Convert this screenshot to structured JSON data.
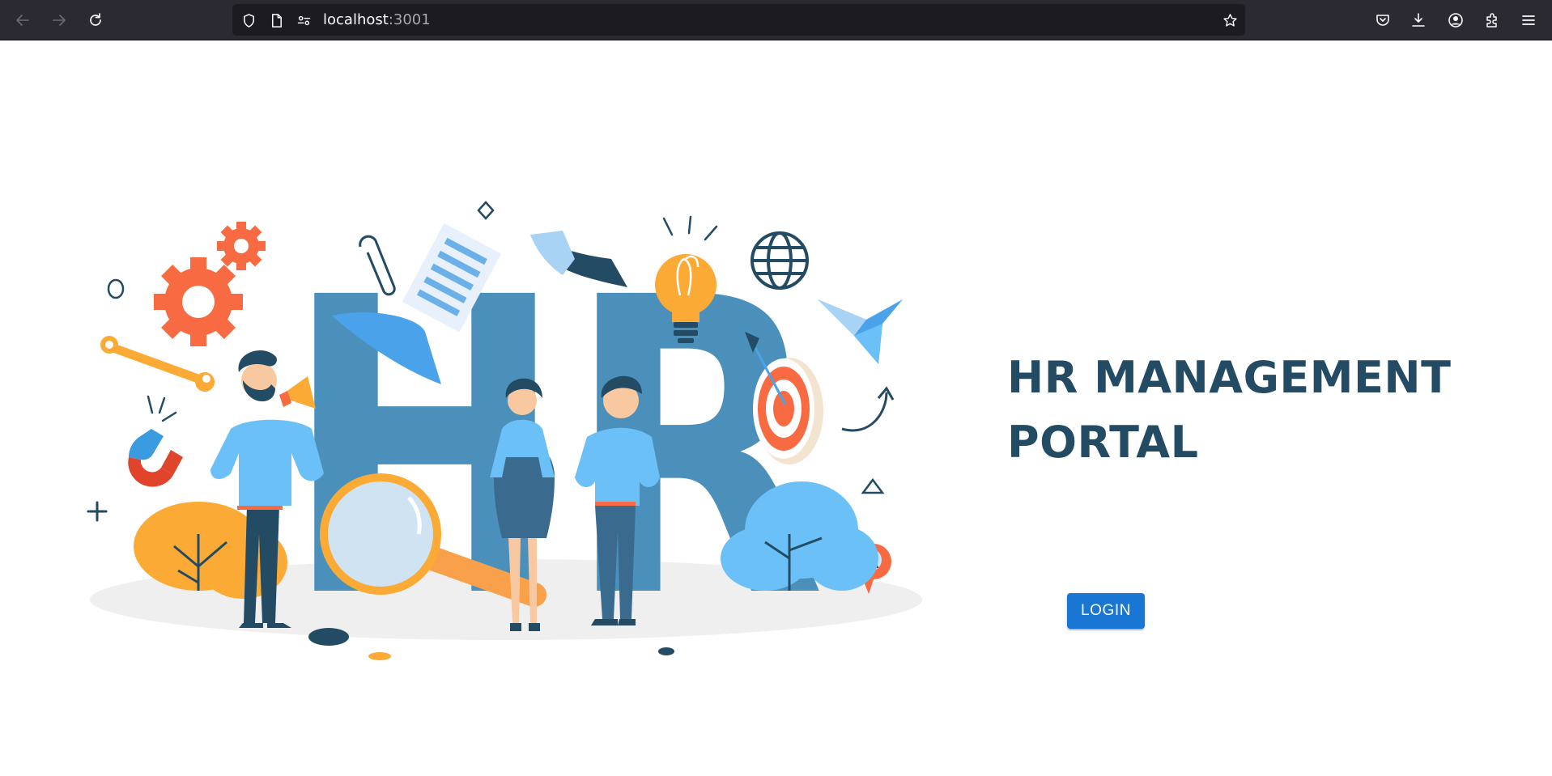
{
  "browser": {
    "url_host": "localhost",
    "url_port": ":3001",
    "icons": {
      "back": "arrow-left",
      "forward": "arrow-right",
      "reload": "reload",
      "tracking_protection": "shield",
      "page_info": "document",
      "permissions": "sliders",
      "bookmark": "star",
      "pocket": "pocket",
      "downloads": "download",
      "account": "account",
      "extensions": "puzzle",
      "menu": "hamburger"
    }
  },
  "page": {
    "title_line1": "HR MANAGEMENT",
    "title_line2": "PORTAL",
    "login_label": "LOGIN",
    "illustration_letters": "HR"
  },
  "colors": {
    "toolbar_bg": "#2b2a33",
    "urlbar_bg": "#1c1b22",
    "title": "#234b63",
    "button": "#1976d2",
    "hr_letters": "#4b8fbb",
    "orange": "#f86a41",
    "yellow": "#fbab35",
    "light_blue": "#6cc0f8"
  }
}
